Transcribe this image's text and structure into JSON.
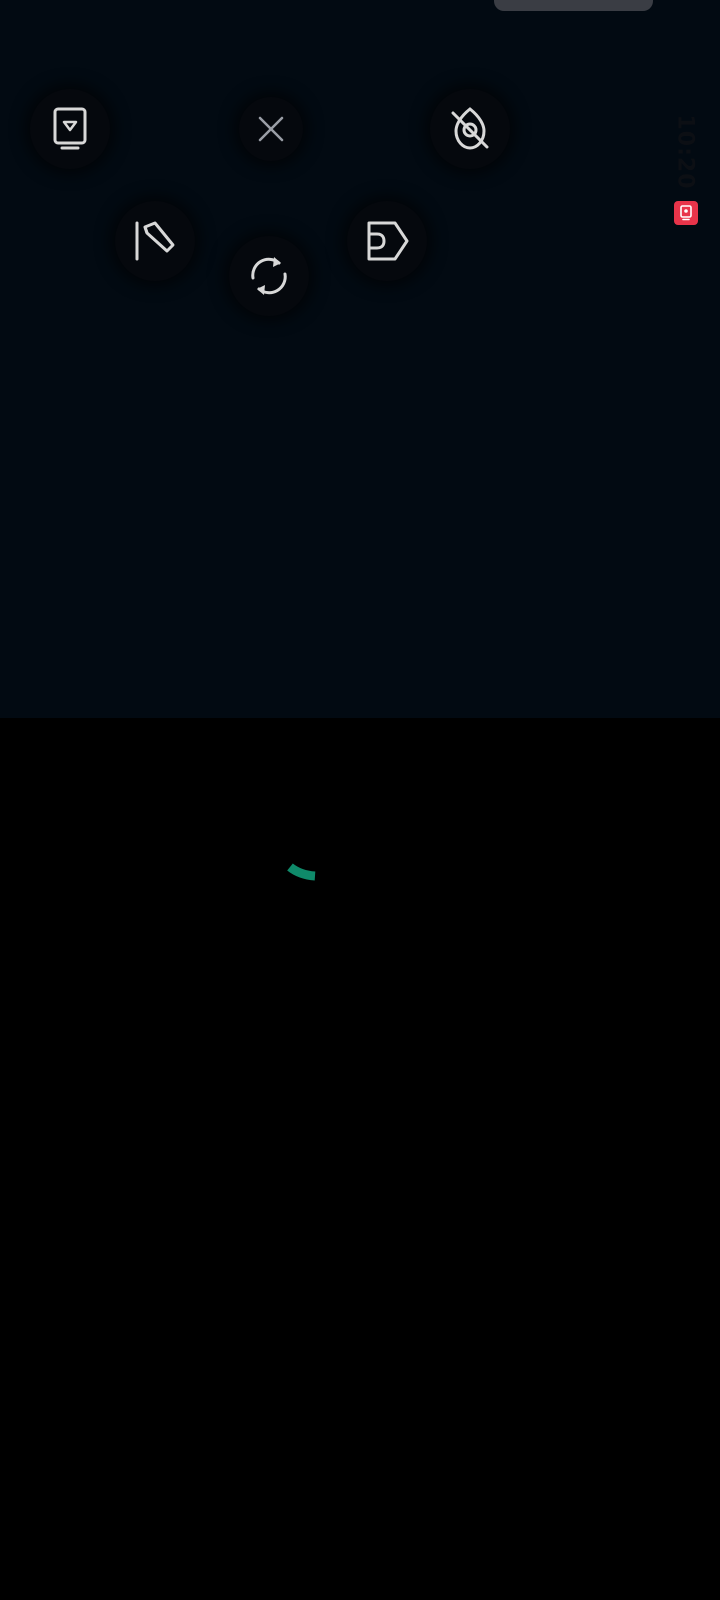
{
  "status_bar": {
    "time": "10:20",
    "badge_icon": "recorder-icon",
    "badge_color": "#e8344a"
  },
  "floating_menu": {
    "buttons": [
      {
        "name": "screen-share-button",
        "icon": "screen-share-icon"
      },
      {
        "name": "close-button",
        "icon": "close-icon"
      },
      {
        "name": "hide-button",
        "icon": "eye-off-icon"
      },
      {
        "name": "edit-button",
        "icon": "pencil-icon"
      },
      {
        "name": "label-button",
        "icon": "tag-icon"
      },
      {
        "name": "rotate-button",
        "icon": "rotate-icon"
      }
    ]
  },
  "loading": {
    "icon": "loading-spinner-icon",
    "color": "#0f8a6a"
  },
  "colors": {
    "panel_bg": "#020a12",
    "screen_bg": "#000000",
    "icon_stroke": "#d8d8d8"
  }
}
